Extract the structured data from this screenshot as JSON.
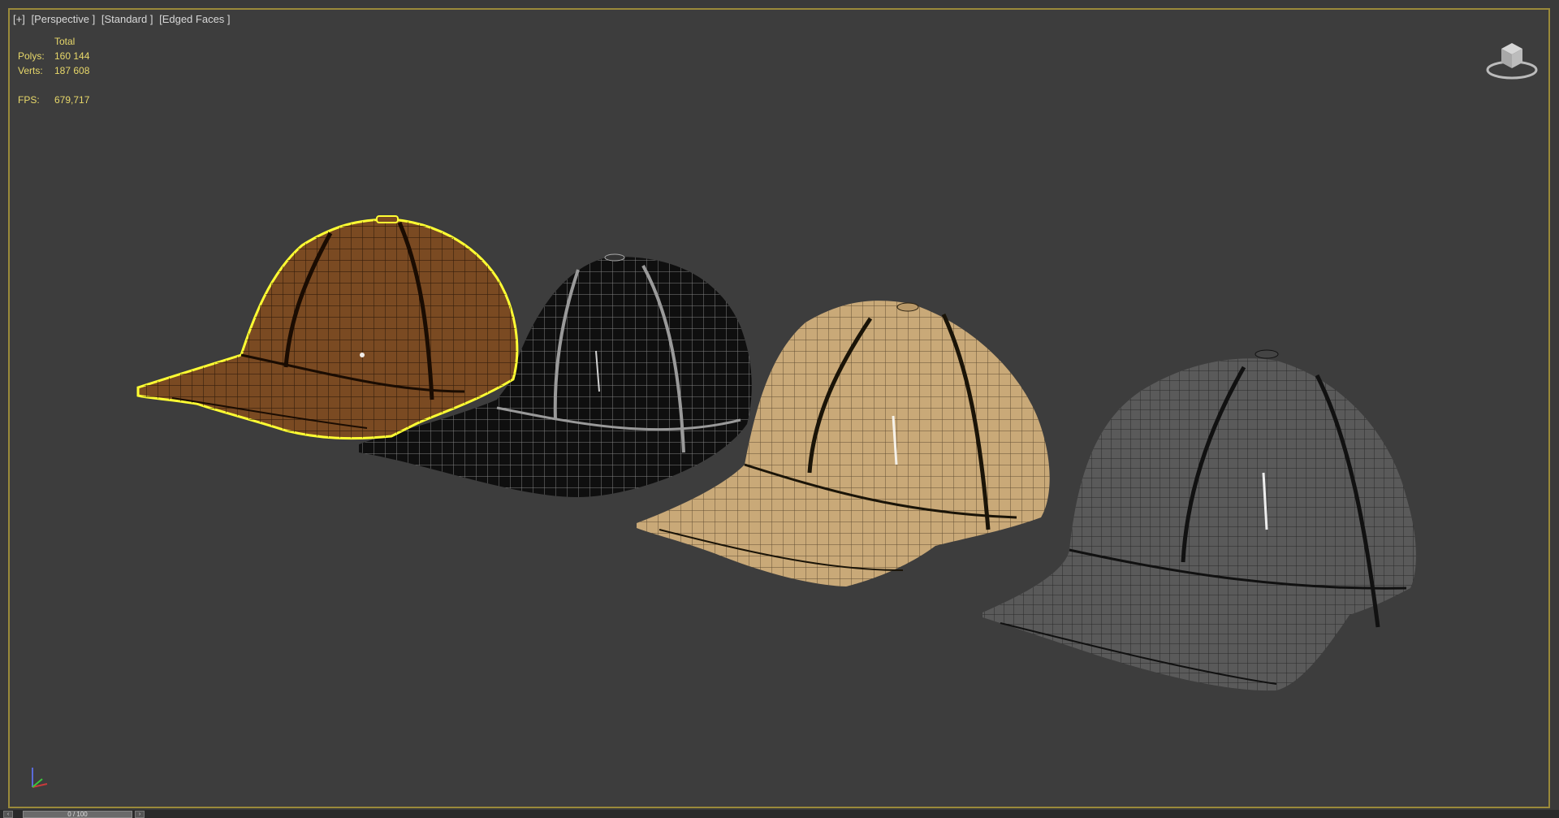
{
  "viewport": {
    "labels": [
      "[+]",
      "[Perspective ]",
      "[Standard ]",
      "[Edged Faces ]"
    ],
    "stats": {
      "header": "Total",
      "polys_label": "Polys:",
      "polys_value": "160 144",
      "verts_label": "Verts:",
      "verts_value": "187 608",
      "fps_label": "FPS:",
      "fps_value": "679,717"
    },
    "selection_color": "#ffff33",
    "border_color": "#9a8a3a"
  },
  "objects": [
    {
      "name": "brown-cap",
      "fill": "#7a4a22",
      "wire": "#1e0f05",
      "selected": true
    },
    {
      "name": "black-cap",
      "fill": "#0f0f0f",
      "wire": "#c8c8c8",
      "selected": false
    },
    {
      "name": "beige-cap",
      "fill": "#c9a978",
      "wire": "#2a2010",
      "selected": false
    },
    {
      "name": "grey-cap",
      "fill": "#5a5a5a",
      "wire": "#151515",
      "selected": false
    }
  ],
  "timeline": {
    "slider_text": "0 / 100",
    "prev_icon": "chevron-left-icon",
    "next_icon": "chevron-right-icon"
  }
}
